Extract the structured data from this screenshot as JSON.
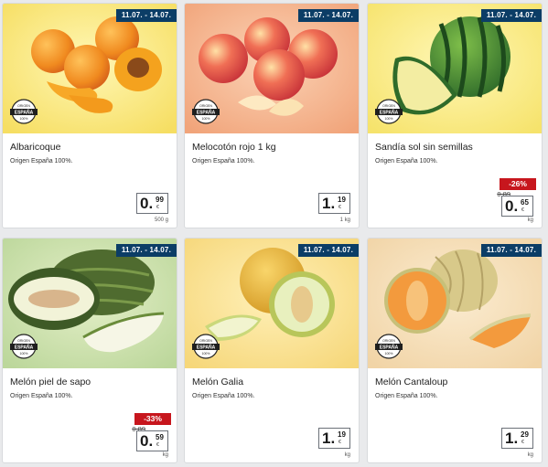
{
  "colors": {
    "date_bg": "#0b3d66",
    "discount_bg": "#c7161d",
    "page_bg": "#e9eaec"
  },
  "badge": {
    "line1": "ORIGEN",
    "line2": "ESPAÑA",
    "line3": "100%",
    "icon": "origen-espana-badge-icon"
  },
  "products": [
    {
      "date_range": "11.07. - 14.07.",
      "name": "Albaricoque",
      "origin": "Origen España 100%.",
      "price_int": "0.",
      "price_dec": "99",
      "currency": "€",
      "unit": "500 g",
      "discount": null,
      "old_price": null,
      "image": "apricots"
    },
    {
      "date_range": "11.07. - 14.07.",
      "name": "Melocotón rojo 1 kg",
      "origin": "Origen España 100%.",
      "price_int": "1.",
      "price_dec": "19",
      "currency": "€",
      "unit": "1 kg",
      "discount": null,
      "old_price": null,
      "image": "peaches"
    },
    {
      "date_range": "11.07. - 14.07.",
      "name": "Sandía sol sin semillas",
      "origin": "Origen España 100%.",
      "price_int": "0.",
      "price_dec": "65",
      "currency": "€",
      "unit": "kg",
      "discount": "-26%",
      "old_price": "0.89",
      "image": "watermelon"
    },
    {
      "date_range": "11.07. - 14.07.",
      "name": "Melón piel de sapo",
      "origin": "Origen España 100%.",
      "price_int": "0.",
      "price_dec": "59",
      "currency": "€",
      "unit": "kg",
      "discount": "-33%",
      "old_price": "0.89",
      "image": "piel-de-sapo"
    },
    {
      "date_range": "11.07. - 14.07.",
      "name": "Melón Galia",
      "origin": "Origen España 100%.",
      "price_int": "1.",
      "price_dec": "19",
      "currency": "€",
      "unit": "kg",
      "discount": null,
      "old_price": null,
      "image": "galia"
    },
    {
      "date_range": "11.07. - 14.07.",
      "name": "Melón Cantaloup",
      "origin": "Origen España 100%.",
      "price_int": "1.",
      "price_dec": "29",
      "currency": "€",
      "unit": "kg",
      "discount": null,
      "old_price": null,
      "image": "cantaloupe"
    }
  ]
}
